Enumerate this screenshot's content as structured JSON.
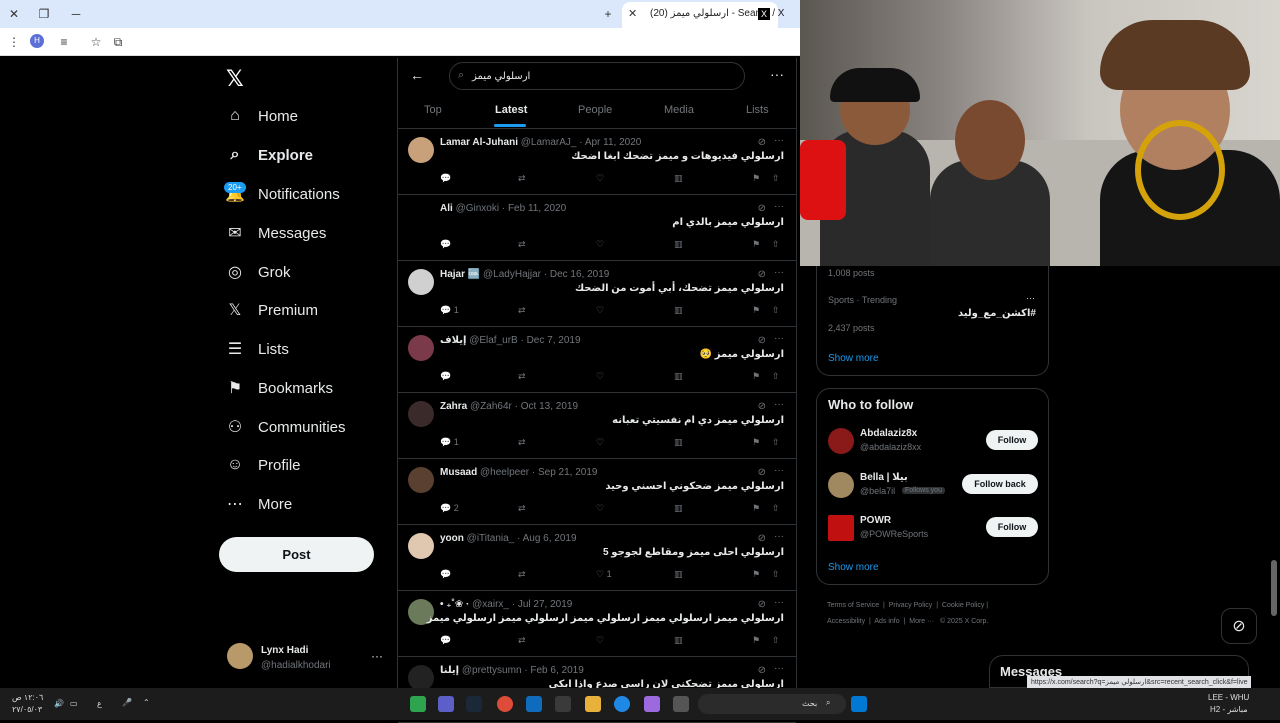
{
  "browser": {
    "tab_title": "(20) ارسلولي ميمز - Search / X",
    "new_tab": "+",
    "minimize": "─",
    "restore": "❐",
    "close": "✕",
    "tab_close": "✕",
    "profile_initial": "H"
  },
  "nav": {
    "logo": "𝕏",
    "items": [
      {
        "label": "Home",
        "icon": "⌂"
      },
      {
        "label": "Explore",
        "icon": "⌕"
      },
      {
        "label": "Notifications",
        "icon": "🔔"
      },
      {
        "label": "Messages",
        "icon": "✉"
      },
      {
        "label": "Grok",
        "icon": "◎"
      },
      {
        "label": "Premium",
        "icon": "𝕏"
      },
      {
        "label": "Lists",
        "icon": "☰"
      },
      {
        "label": "Bookmarks",
        "icon": "⚑"
      },
      {
        "label": "Communities",
        "icon": "⚇"
      },
      {
        "label": "Profile",
        "icon": "☺"
      },
      {
        "label": "More",
        "icon": "⋯"
      }
    ],
    "notif_badge": "20+",
    "post_label": "Post",
    "account": {
      "name": "Lynx Hadi",
      "handle": "@hadialkhodari",
      "more": "···"
    }
  },
  "search": {
    "query": "ارسلولي ميمز",
    "tabs": [
      "Top",
      "Latest",
      "People",
      "Media",
      "Lists"
    ],
    "active_tab": "Latest"
  },
  "tweets": [
    {
      "name": "Lamar Al-Juhani",
      "meta": "@LamarAJ_ · Apr 11, 2020",
      "text": "ارسلولي فيديوهات و ميمز تضحك ابغا اضحك",
      "replies": "",
      "retweets": "",
      "likes": "",
      "avatar_color": "#c8a07a"
    },
    {
      "name": "Ali",
      "meta": "@Ginxoki · Feb 11, 2020",
      "text": "ارسلولي ميمز بالدي ام",
      "replies": "",
      "retweets": "",
      "likes": "",
      "avatar_color": "#000000"
    },
    {
      "name": "Hajar 🆒",
      "meta": "@LadyHajjar · Dec 16, 2019",
      "text": "ارسلولي ميمز تضحك، أبي أموت من الضحك",
      "replies": "1",
      "retweets": "",
      "likes": "",
      "avatar_color": "#d0d0d0"
    },
    {
      "name": "إيلاف",
      "meta": "@Elaf_urB · Dec 7, 2019",
      "text": "ارسلولي ميمز 🥺",
      "replies": "",
      "retweets": "",
      "likes": "",
      "avatar_color": "#7a3a4a"
    },
    {
      "name": "Zahra",
      "meta": "@Zah64r · Oct 13, 2019",
      "text": "ارسلولي ميمز دي ام نفسيتي تعبانه",
      "replies": "1",
      "retweets": "",
      "likes": "",
      "avatar_color": "#3a2a2a"
    },
    {
      "name": "Musaad",
      "meta": "@heelpeer · Sep 21, 2019",
      "text": "ارسلولي ميمز ضحكوني احسني وحيد",
      "replies": "2",
      "retweets": "",
      "likes": "",
      "avatar_color": "#5a4030"
    },
    {
      "name": "yoon",
      "meta": "@iTitania_ · Aug 6, 2019",
      "text": "ارسلولي احلى ميمز ومقاطع لجوجو 5",
      "replies": "",
      "retweets": "",
      "likes": "1",
      "avatar_color": "#e0c8b0"
    },
    {
      "name": "• ₊˚❀ ·",
      "meta": "@xairx_ · Jul 27, 2019",
      "text": "ارسلولي ميمز ارسلولي ميمز ارسلولي ميمز ارسلولي ميمز ارسلولي ميمز",
      "replies": "",
      "retweets": "",
      "likes": "",
      "avatar_color": "#6a7a5a"
    },
    {
      "name": "إيلنا",
      "meta": "@prettysumn · Feb 6, 2019",
      "text": "ارسلولي ميمز تضحكني لان راسي صدع واذا ابكي",
      "replies": "",
      "retweets": "",
      "likes": "",
      "avatar_color": "#222222"
    }
  ],
  "trends": {
    "top_count": "1,008 posts",
    "category": "Sports · Trending",
    "hashtag": "#اكشن_مع_وليد",
    "count": "2,437 posts",
    "show_more": "Show more"
  },
  "who_to_follow": {
    "title": "Who to follow",
    "accounts": [
      {
        "name": "Abdalaziz8x",
        "handle": "@abdalaziz8xx",
        "button": "Follow",
        "follows_you": "",
        "avatar_color": "#8a1a1a"
      },
      {
        "name": "Bella | بيلا",
        "handle": "@bela7il",
        "button": "Follow back",
        "follows_you": "Follows you",
        "avatar_color": "#a08860"
      },
      {
        "name": "POWR",
        "handle": "@POWReSports",
        "button": "Follow",
        "follows_you": "",
        "avatar_color": "#c01010"
      }
    ],
    "show_more": "Show more"
  },
  "footer": {
    "links": [
      "Terms of Service",
      "Privacy Policy",
      "Cookie Policy",
      "Accessibility",
      "Ads info",
      "More ···",
      "© 2025 X Corp."
    ]
  },
  "messages_drawer": "Messages",
  "status_url": "https://x.com/search?q=ارسلولي ميمز&src=recent_search_click&f=live",
  "taskbar": {
    "time": "١٢:٠٦ ص",
    "date": "٢٧/٠٥/٠٣",
    "lang": "ع",
    "search_placeholder": "بحث",
    "right_label": "LEE - WHU",
    "right_sub": "H2 - مباشر"
  },
  "colors": {
    "accent": "#1d9bf0",
    "bg": "#000000",
    "border": "#2f3336",
    "muted": "#71767b"
  }
}
